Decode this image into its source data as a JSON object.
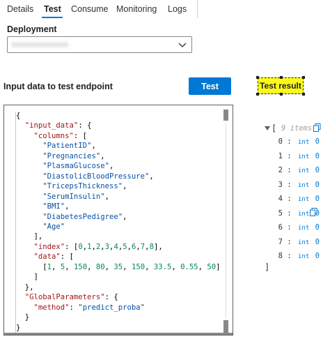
{
  "tabs": [
    {
      "label": "Details"
    },
    {
      "label": "Test"
    },
    {
      "label": "Consume"
    },
    {
      "label": "Monitoring"
    },
    {
      "label": "Logs"
    }
  ],
  "deployment": {
    "label": "Deployment",
    "value": "xxxxxxxxxxxxxx"
  },
  "input_label": "Input data to test endpoint",
  "test_button": "Test",
  "test_result_label": "Test result",
  "result": {
    "items_count": "9 items",
    "rows": [
      {
        "index": "0",
        "separator": ":",
        "type": "int",
        "value": "0"
      },
      {
        "index": "1",
        "separator": ":",
        "type": "int",
        "value": "0"
      },
      {
        "index": "2",
        "separator": ":",
        "type": "int",
        "value": "0"
      },
      {
        "index": "3",
        "separator": ":",
        "type": "int",
        "value": "0"
      },
      {
        "index": "4",
        "separator": ":",
        "type": "int",
        "value": "0"
      },
      {
        "index": "5",
        "separator": ":",
        "type": "int",
        "value": "0"
      },
      {
        "index": "6",
        "separator": ":",
        "type": "int",
        "value": "0"
      },
      {
        "index": "7",
        "separator": ":",
        "type": "int",
        "value": "0"
      },
      {
        "index": "8",
        "separator": ":",
        "type": "int",
        "value": "0"
      }
    ]
  },
  "accent_color": "#0078d4",
  "highlight_color": "#fbf91a",
  "icons": [
    "chevron-down-icon",
    "copy-icon",
    "expand-arrow-icon"
  ]
}
